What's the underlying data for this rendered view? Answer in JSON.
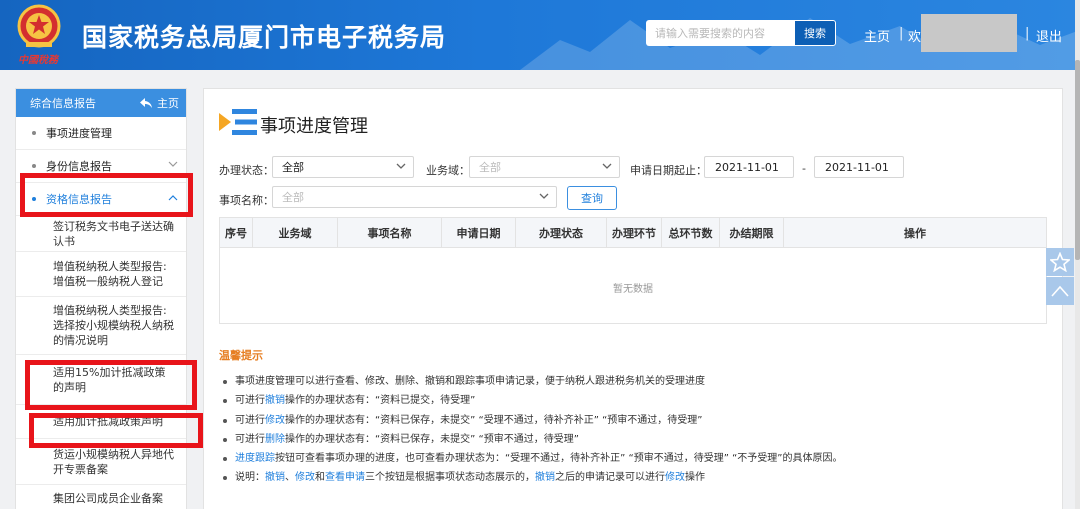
{
  "header": {
    "site_title": "国家税务总局厦门市电子税务局",
    "slogan": "中國稅務",
    "search_placeholder": "请输入需要搜索的内容",
    "search_button": "搜索",
    "nav_home": "主页",
    "nav_sep": "|",
    "welcome": "欢",
    "logout": "退出"
  },
  "sidebar": {
    "header_label": "综合信息报告",
    "header_home": "主页",
    "items": [
      {
        "label": "事项进度管理"
      },
      {
        "label": "身份信息报告"
      },
      {
        "label": "资格信息报告"
      }
    ],
    "sub_items": [
      {
        "label": "签订税务文书电子送达确认书"
      },
      {
        "label": "增值税纳税人类型报告:增值税一般纳税人登记"
      },
      {
        "label": "增值税纳税人类型报告:选择按小规模纳税人纳税的情况说明"
      },
      {
        "label": "适用15%加计抵减政策的声明"
      },
      {
        "label": "适用加计抵减政策声明"
      },
      {
        "label": "货运小规模纳税人异地代开专票备案"
      },
      {
        "label": "集团公司成员企业备案"
      }
    ]
  },
  "main": {
    "title": "事项进度管理",
    "filters": {
      "status_label": "办理状态：",
      "status_value": "全部",
      "domain_label": "业务域：",
      "domain_value": "全部",
      "date_label": "申请日期起止：",
      "date_from": "2021-11-01",
      "date_sep": "-",
      "date_to": "2021-11-01",
      "name_label": "事项名称：",
      "name_value": "全部",
      "query_button": "查询"
    },
    "table": {
      "columns": [
        "序号",
        "业务域",
        "事项名称",
        "申请日期",
        "办理状态",
        "办理环节",
        "总环节数",
        "办结期限",
        "操作"
      ],
      "empty_text": "暂无数据"
    },
    "tips": {
      "title": "温馨提示",
      "items": [
        {
          "text": "事项进度管理可以进行查看、修改、删除、撤销和跟踪事项申请记录，便于纳税人跟进税务机关的受理进度"
        },
        {
          "pre": "可进行",
          "link": "撤销",
          "post": "操作的办理状态有：“资料已提交，待受理”"
        },
        {
          "pre": "可进行",
          "link": "修改",
          "post": "操作的办理状态有：“资料已保存，未提交”  “受理不通过，待补齐补正”  “预审不通过，待受理”"
        },
        {
          "pre": "可进行",
          "link": "删除",
          "post": "操作的办理状态有：“资料已保存，未提交”  “预审不通过，待受理”"
        },
        {
          "link": "进度跟踪",
          "post": "按钮可查看事项办理的进度，也可查看办理状态为：“受理不通过，待补齐补正”  “预审不通过，待受理”  “不予受理”的具体原因。"
        },
        {
          "pre": "说明：",
          "l1": "撤销",
          "s1": "、",
          "l2": "修改",
          "s2": "和",
          "l3": "查看申请",
          "s3": "三个按钮是根据事项状态动态展示的，",
          "l4": "撤销",
          "s4": "之后的申请记录可以进行",
          "l5": "修改",
          "s5": "操作"
        }
      ]
    }
  },
  "colors": {
    "header_blue": "#1e78d8",
    "accent_blue": "#1f7fdc",
    "tips_orange": "#e67e22",
    "annotation_red": "#e8141a"
  },
  "icons": [
    "national-emblem-icon",
    "home-arrow-icon",
    "chevron-down-icon",
    "chevron-up-icon",
    "menu-list-icon",
    "star-icon",
    "arrow-up-icon"
  ]
}
